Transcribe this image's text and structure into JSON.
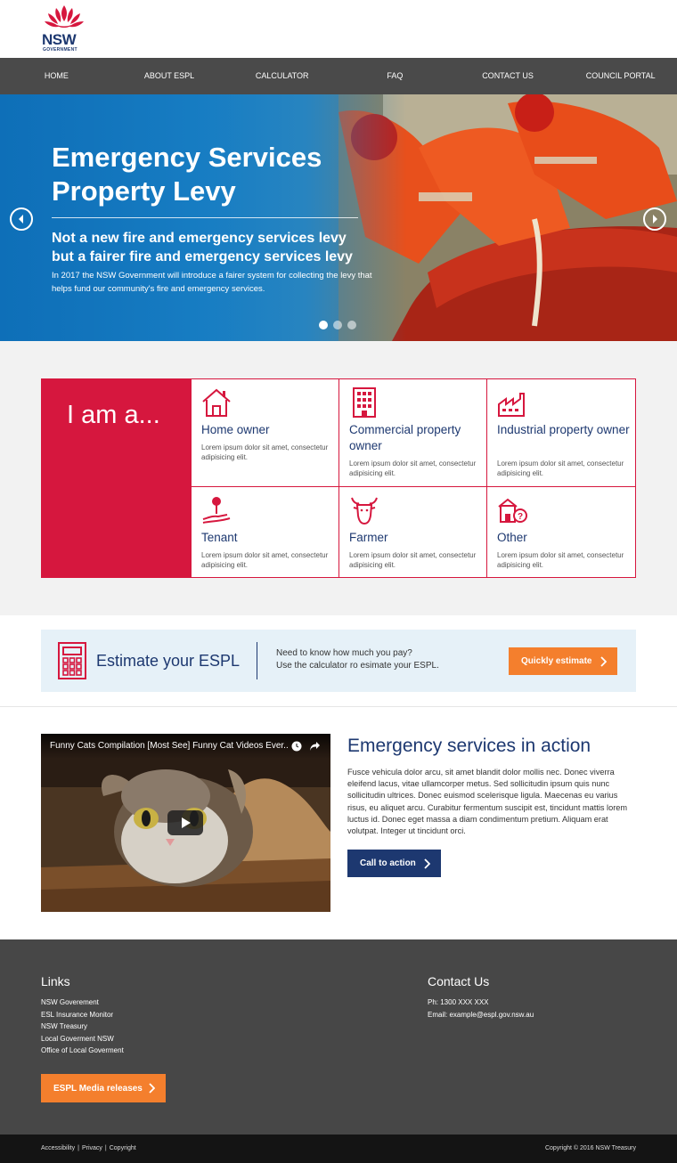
{
  "brand": {
    "name": "NSW",
    "sub": "GOVERNMENT"
  },
  "nav": [
    "HOME",
    "ABOUT ESPL",
    "CALCULATOR",
    "FAQ",
    "CONTACT US",
    "COUNCIL PORTAL"
  ],
  "hero": {
    "title": "Emergency Services Property Levy",
    "subtitle": "Not a new fire and emergency services levy but a fairer fire and emergency services levy",
    "body": "In 2017 the NSW Government will introduce a fairer system for collecting the levy that helps fund our community's fire and emergency services.",
    "slide_count": 3,
    "active_slide": 1
  },
  "iam": {
    "heading": "I am a...",
    "cards": [
      {
        "title": "Home owner",
        "desc": "Lorem ipsum dolor sit amet, consectetur adipisicing elit.",
        "icon": "house-icon"
      },
      {
        "title": "Commercial property owner",
        "desc": "Lorem ipsum dolor sit amet, consectetur adipisicing elit.",
        "icon": "building-icon"
      },
      {
        "title": "Industrial property owner",
        "desc": "Lorem ipsum dolor sit amet, consectetur adipisicing elit.",
        "icon": "factory-icon"
      },
      {
        "title": "Tenant",
        "desc": "Lorem ipsum dolor sit amet, consectetur adipisicing elit.",
        "icon": "key-hand-icon"
      },
      {
        "title": "Farmer",
        "desc": "Lorem ipsum dolor sit amet, consectetur adipisicing elit.",
        "icon": "cow-icon"
      },
      {
        "title": "Other",
        "desc": "Lorem ipsum dolor sit amet, consectetur adipisicing elit.",
        "icon": "question-house-icon"
      }
    ]
  },
  "estimate": {
    "title": "Estimate your ESPL",
    "line1": "Need to know how much you pay?",
    "line2": "Use the calculator ro esimate your ESPL.",
    "button": "Quickly estimate"
  },
  "video": {
    "title": "Funny Cats Compilation [Most See] Funny Cat Videos Ever..."
  },
  "action": {
    "title": "Emergency services in action",
    "body": "Fusce vehicula dolor arcu, sit amet blandit dolor mollis nec. Donec viverra eleifend lacus, vitae ullamcorper metus. Sed sollicitudin ipsum quis nunc sollicitudin ultrices. Donec euismod scelerisque ligula. Maecenas eu varius risus, eu aliquet arcu. Curabitur fermentum suscipit est, tincidunt mattis lorem luctus id. Donec eget massa a diam condimentum pretium. Aliquam erat volutpat. Integer ut tincidunt orci.",
    "button": "Call to action"
  },
  "footer": {
    "links_heading": "Links",
    "links": [
      "NSW Goverement",
      "ESL Insurance Monitor",
      "NSW Treasury",
      "Local Goverment NSW",
      "Office of Local Goverment"
    ],
    "media_button": "ESPL Media releases",
    "contact_heading": "Contact Us",
    "phone": "Ph: 1300 XXX XXX",
    "email": "Email: example@espl.gov.nsw.au",
    "bottom_links": [
      "Accessibility",
      "Privacy",
      "Copyright"
    ],
    "copyright": "Copyright © 2016 NSW Treasury"
  },
  "colors": {
    "red": "#d6173e",
    "navy": "#1d3870",
    "orange": "#f47f2d",
    "nav": "#4a4a4a",
    "footer": "#474747"
  }
}
